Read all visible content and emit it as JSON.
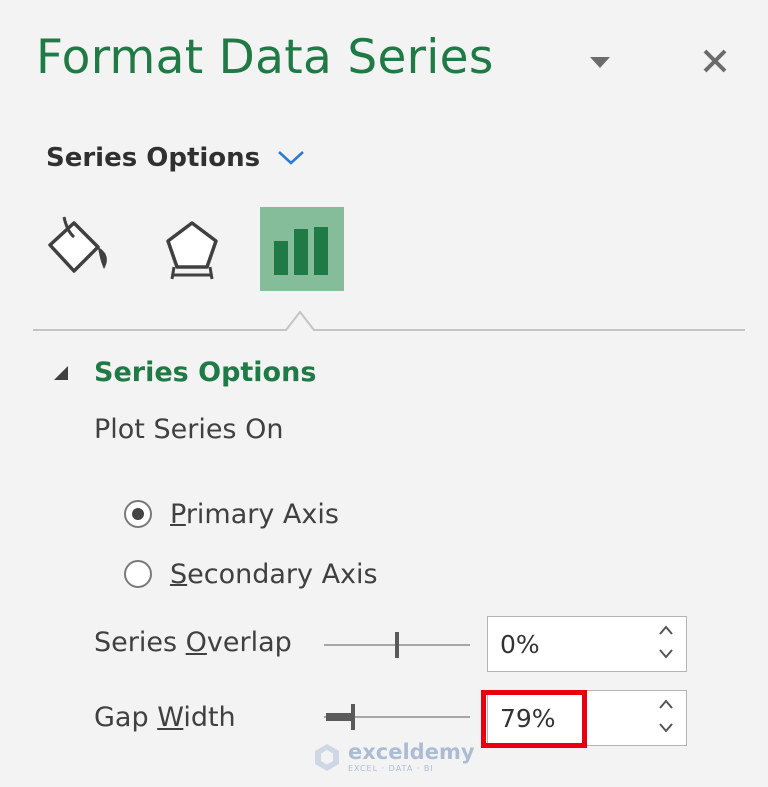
{
  "pane": {
    "title": "Format Data Series"
  },
  "category": {
    "label": "Series Options"
  },
  "tabs": [
    {
      "icon": "fill-line-icon"
    },
    {
      "icon": "effects-icon"
    },
    {
      "icon": "series-options-icon",
      "selected": true
    }
  ],
  "section": {
    "title": "Series Options",
    "plot_on_label": "Plot Series On",
    "axis_options": [
      {
        "pre": "",
        "key": "P",
        "post": "rimary Axis",
        "selected": true
      },
      {
        "pre": "",
        "key": "S",
        "post": "econdary Axis",
        "selected": false
      }
    ],
    "overlap": {
      "pre": "Series ",
      "key": "O",
      "post": "verlap",
      "value": "0%",
      "level": 0
    },
    "gap_width": {
      "pre": "Gap ",
      "key": "W",
      "post": "idth",
      "value": "79%",
      "level": 79
    }
  },
  "watermark": {
    "name": "exceldemy",
    "tagline": "EXCEL · DATA · BI"
  },
  "colors": {
    "accent": "#1f7a45",
    "selected_tab": "#85bd9b",
    "highlight": "#e8000e"
  }
}
